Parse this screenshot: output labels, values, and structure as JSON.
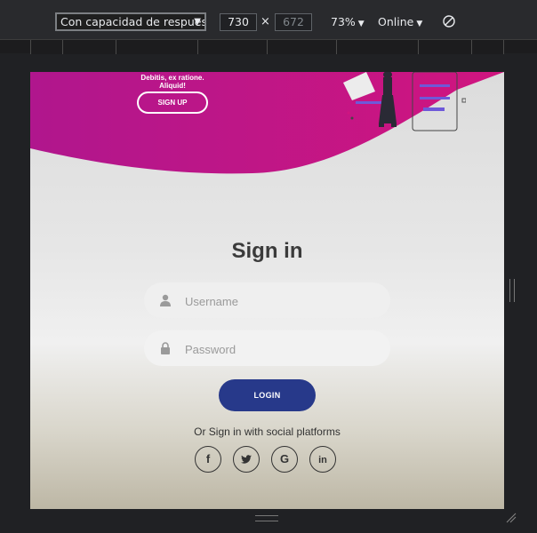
{
  "devtools": {
    "device_select": "Con capacidad de respuesta",
    "width": "730",
    "times": "×",
    "height": "672",
    "zoom": "73%",
    "network": "Online"
  },
  "page": {
    "hero": {
      "text": "Debitis, ex ratione. Aliquid!",
      "signup_label": "SIGN UP"
    },
    "signin": {
      "title": "Sign in",
      "username_placeholder": "Username",
      "password_placeholder": "Password",
      "login_label": "LOGIN",
      "social_text": "Or Sign in with social platforms",
      "social": [
        {
          "name": "facebook",
          "glyph": "f"
        },
        {
          "name": "twitter",
          "glyph": "t"
        },
        {
          "name": "google",
          "glyph": "G"
        },
        {
          "name": "linkedin",
          "glyph": "in"
        }
      ]
    }
  },
  "colors": {
    "brand_magenta": "#b0168d",
    "login_blue": "#27398a",
    "title_text": "#3b3b3b"
  }
}
